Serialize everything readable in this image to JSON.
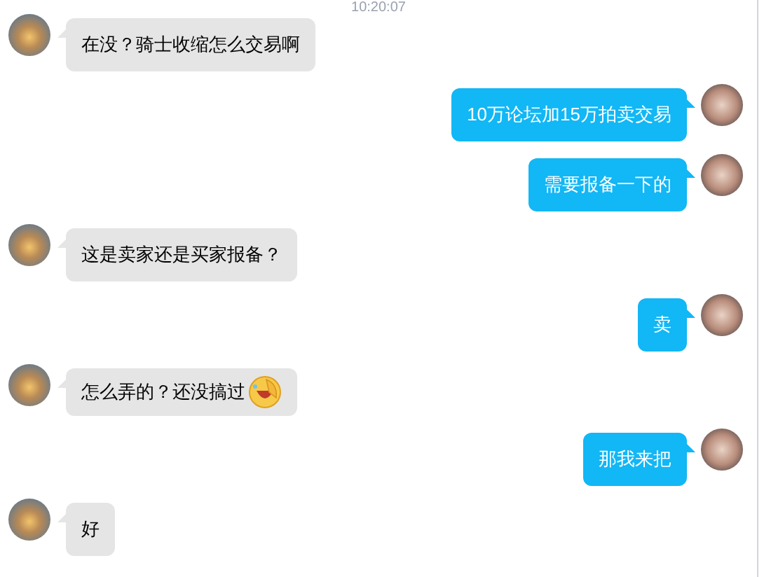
{
  "timestamp": "10:20:07",
  "messages": [
    {
      "kind": "incoming",
      "text": "在没？骑士收缩怎么交易啊",
      "has_emoji": false
    },
    {
      "kind": "outgoing",
      "text": "10万论坛加15万拍卖交易",
      "has_emoji": false
    },
    {
      "kind": "outgoing",
      "text": "需要报备一下的",
      "has_emoji": false
    },
    {
      "kind": "incoming",
      "text": "这是卖家还是买家报备？",
      "has_emoji": false
    },
    {
      "kind": "outgoing",
      "text": "卖",
      "has_emoji": false
    },
    {
      "kind": "incoming",
      "text": "怎么弄的？还没搞过",
      "has_emoji": true
    },
    {
      "kind": "outgoing",
      "text": "那我来把",
      "has_emoji": false
    },
    {
      "kind": "incoming",
      "text": "好",
      "has_emoji": false
    }
  ]
}
